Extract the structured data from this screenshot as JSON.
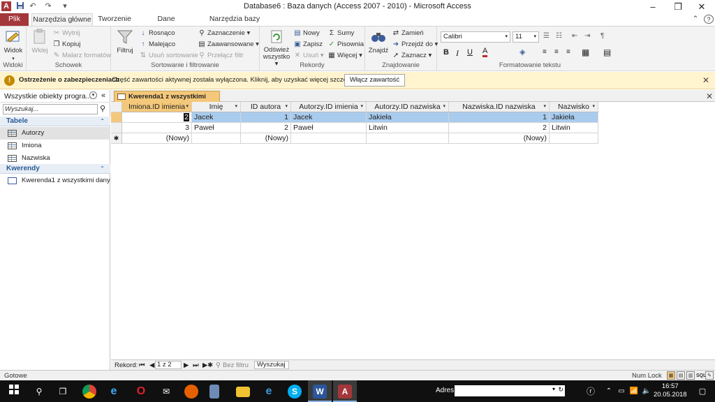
{
  "window": {
    "title": "Database6 : Baza danych (Access 2007 - 2010)  -  Microsoft Access",
    "app_icon": "A",
    "minimize": "–",
    "maximize": "❐",
    "close": "✕",
    "help": "?"
  },
  "tabs": [
    "Plik",
    "Narzędzia główne",
    "Tworzenie",
    "Dane zewnętrzne",
    "Narzędzia bazy danych"
  ],
  "ribbon": {
    "widoki": {
      "label": "Widoki",
      "widok": "Widok"
    },
    "schowek": {
      "label": "Schowek",
      "wklej": "Wklej",
      "wytnij": "Wytnij",
      "kopiuj": "Kopiuj",
      "malarz": "Malarz formatów"
    },
    "sort": {
      "label": "Sortowanie i filtrowanie",
      "filtruj": "Filtruj",
      "rosnaco": "Rosnąco",
      "malejaco": "Malejąco",
      "usun_sort": "Usuń sortowanie",
      "zaznaczenie": "Zaznaczenie",
      "zaawansowane": "Zaawansowane",
      "przelacz": "Przełącz filtr"
    },
    "rekordy": {
      "label": "Rekordy",
      "odswiez": "Odśwież wszystko",
      "nowy": "Nowy",
      "zapisz": "Zapisz",
      "usun": "Usuń",
      "sumy": "Sumy",
      "pisownia": "Pisownia",
      "wiecej": "Więcej"
    },
    "znajdowanie": {
      "label": "Znajdowanie",
      "znajdz": "Znajdź",
      "zamien": "Zamień",
      "przejdz": "Przejdź do",
      "zaznacz": "Zaznacz"
    },
    "formatowanie": {
      "label": "Formatowanie tekstu",
      "font": "Calibri",
      "size": "11"
    }
  },
  "security": {
    "title": "Ostrzeżenie o zabezpieczeniach",
    "message": "Część zawartości aktywnej została wyłączona. Kliknij, aby uzyskać więcej szczegółów.",
    "button": "Włącz zawartość"
  },
  "nav": {
    "header": "Wszystkie obiekty progra...",
    "search_placeholder": "Wyszukaj...",
    "sections": [
      {
        "title": "Tabele",
        "items": [
          "Autorzy",
          "Imiona",
          "Nazwiska"
        ]
      },
      {
        "title": "Kwerendy",
        "items": [
          "Kwerenda1 z wszystkimi dany..."
        ]
      }
    ]
  },
  "document": {
    "tab_title": "Kwerenda1 z wszystkimi danymi",
    "columns": [
      "Imiona.ID imienia",
      "Imię",
      "ID autora",
      "Autorzy.ID imienia",
      "Autorzy.ID nazwiska",
      "Nazwiska.ID nazwiska",
      "Nazwisko"
    ],
    "rows": [
      [
        "2",
        "Jacek",
        "1",
        "Jacek",
        "Jakieła",
        "1",
        "Jakieła"
      ],
      [
        "3",
        "Paweł",
        "2",
        "Paweł",
        "Litwin",
        "2",
        "Litwin"
      ]
    ],
    "new_row": [
      "(Nowy)",
      "",
      "(Nowy)",
      "",
      "",
      "(Nowy)",
      ""
    ],
    "new_row_marker": "✱"
  },
  "record_nav": {
    "label": "Rekord:",
    "position": "1 z 2",
    "filter": "Bez filtru",
    "search": "Wyszukaj"
  },
  "status": {
    "left": "Gotowe",
    "numlock": "Num Lock",
    "sql": "SQL"
  },
  "taskbar": {
    "address_label": "Adres",
    "time": "16:57",
    "date": "20.05.2018"
  }
}
